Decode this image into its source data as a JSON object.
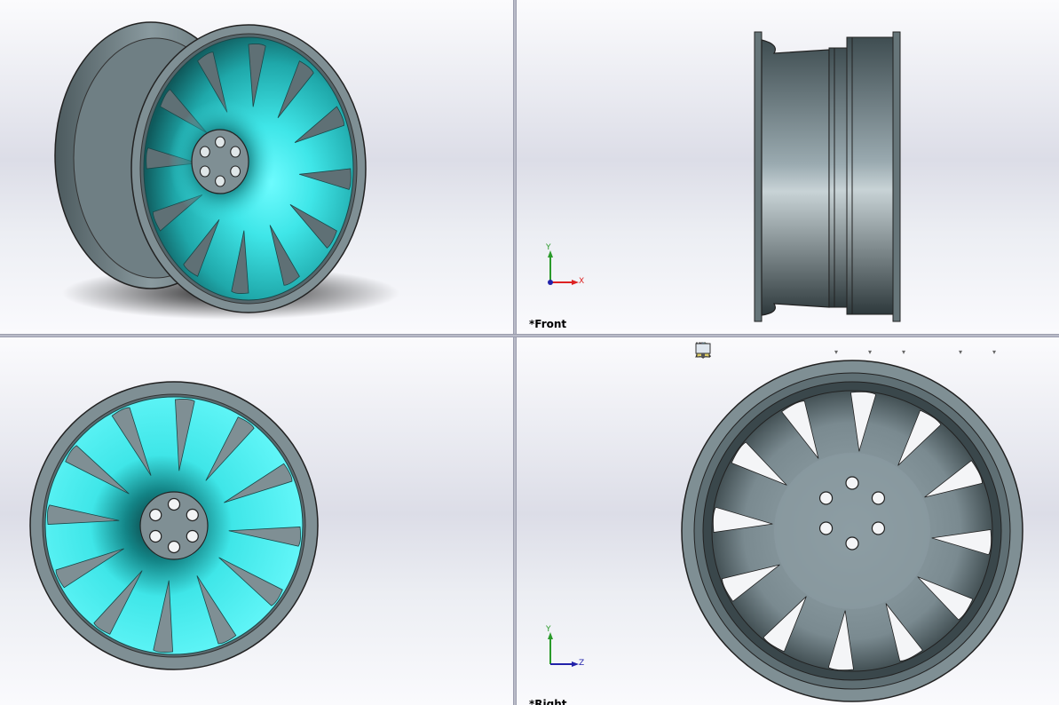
{
  "viewports": {
    "front_label": "*Front",
    "right_label": "*Right"
  },
  "triad_front": {
    "y": "Y",
    "x": "X"
  },
  "triad_right": {
    "y": "Y",
    "z": "Z"
  },
  "toolbar": {
    "icons": [
      "zoom-to-fit-icon",
      "zoom-to-area-icon",
      "previous-view-icon",
      "section-view-icon",
      "dynamic-annotation-icon",
      "view-orientation-icon",
      "display-style-icon",
      "hide-show-items-icon",
      "edit-appearance-icon",
      "apply-scene-icon",
      "view-settings-icon"
    ]
  },
  "colors": {
    "spoke_cyan": "#4ff0f0",
    "rim_gray": "#7f8f94",
    "background_top": "#fbfbfd",
    "background_mid": "#dcdde7"
  }
}
